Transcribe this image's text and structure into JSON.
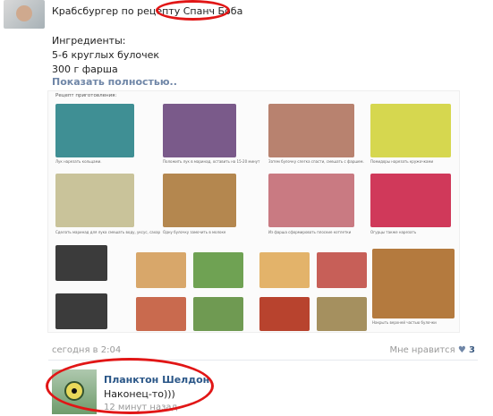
{
  "post": {
    "title_prefix": "Крабсбургер по рецепту ",
    "title_highlight": "Спанч Боба",
    "ingredients": [
      "Ингредиенты:",
      "5-6 круглых булочек",
      "300 г фарша"
    ],
    "show_more": "Показать полностью..",
    "timestamp": "сегодня в 2:04",
    "likes_label": "Мне нравится",
    "likes_count": "3"
  },
  "recipe": {
    "title": "Рецепт приготовления:",
    "steps": [
      {
        "caption": "Лук нарезать кольцами.",
        "color": "#3f8f94"
      },
      {
        "caption": "Положить лук в маринад, оставить на 15-20 минут",
        "color": "#7a5a8a"
      },
      {
        "caption": "Затем булочку слегка спасти, смешать с фаршем.",
        "color": "#b8826f"
      },
      {
        "caption": "Помидоры нарезать кружочками",
        "color": "#d6d74f"
      },
      {
        "caption": "Сделать маринад для лука смешать воду, уксус, сахар",
        "color": "#c9c39a"
      },
      {
        "caption": "Одну булочку замочить в молоке",
        "color": "#b4874f"
      },
      {
        "caption": "Из фарша сформировать плоские котлетки",
        "color": "#c97a82"
      },
      {
        "caption": "Огурцы также нарезать",
        "color": "#d0395a"
      },
      {
        "caption": "",
        "color": "#3b3b3b"
      },
      {
        "caption": "",
        "color": "#d8a76a"
      },
      {
        "caption": "",
        "color": "#6fa253"
      },
      {
        "caption": "",
        "color": "#e3b36a"
      },
      {
        "caption": "",
        "color": "#c75f58"
      },
      {
        "caption": "",
        "color": "#2f2f2f"
      },
      {
        "caption": "",
        "color": "#c96a4e"
      },
      {
        "caption": "",
        "color": "#6f9a52"
      },
      {
        "caption": "",
        "color": "#b8432e"
      },
      {
        "caption": "",
        "color": "#a5905f"
      },
      {
        "caption": "Накрыть верхней частью булочки",
        "color": "#b47a3e"
      }
    ]
  },
  "comment": {
    "author": "Планктон Шелдон",
    "text": "Наконец-то)))",
    "time": "12 минут назад"
  },
  "colors": {
    "highlight": "#e11616",
    "link": "#2b5788",
    "muted": "#999999"
  }
}
